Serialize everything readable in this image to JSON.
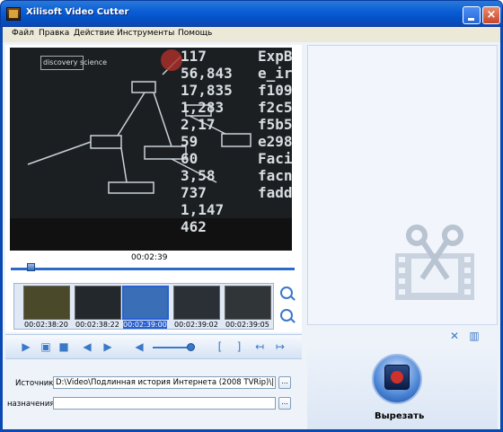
{
  "window": {
    "title": "Xilisoft Video Cutter",
    "close_glyph": "×"
  },
  "menu": [
    "Файл",
    "Правка",
    "Действие",
    "Инструменты",
    "Помощь"
  ],
  "player": {
    "current_time": "00:02:39",
    "video_overlay": {
      "logo_text": "discovery science",
      "numbers": [
        "117",
        "56,843",
        "17,835",
        "1,283",
        "2,17",
        "59",
        "60",
        "3,58",
        "737",
        "1,147",
        "462"
      ],
      "hex": [
        "ExpB",
        "e_ir",
        "f109",
        "f2c5",
        "f5b5",
        "e298",
        "Faci",
        "facn",
        "fadd"
      ]
    },
    "position_fraction": 0.07
  },
  "thumbnails": [
    {
      "time": "00:02:38:20",
      "selected": false,
      "color": "#4a4a2a"
    },
    {
      "time": "00:02:38:22",
      "selected": false,
      "color": "#23282c"
    },
    {
      "time": "00:02:39:00",
      "selected": true,
      "color": "#3a6fb8"
    },
    {
      "time": "00:02:39:02",
      "selected": false,
      "color": "#2a3036"
    },
    {
      "time": "00:02:39:05",
      "selected": false,
      "color": "#303538"
    }
  ],
  "controls": {
    "icons": [
      "play-icon",
      "open-file-icon",
      "stop-icon",
      "prev-frame-icon",
      "next-frame-icon",
      "volume-icon",
      "mark-icon",
      "mark-end-icon",
      "jump-start-icon",
      "jump-end-icon"
    ],
    "volume_fraction": 0.82
  },
  "source": {
    "label": "Источник:",
    "value": "D:\\Video\\Подлинная история Интернета (2008 TVRip)\\|",
    "browse_label": "..."
  },
  "destination": {
    "label": "назначения:",
    "value": "",
    "browse_label": "..."
  },
  "cut": {
    "label": "Вырезать"
  },
  "colors": {
    "accent": "#2860d0",
    "titlebar": "#0b5fd6",
    "frame": "#eef3fa"
  }
}
